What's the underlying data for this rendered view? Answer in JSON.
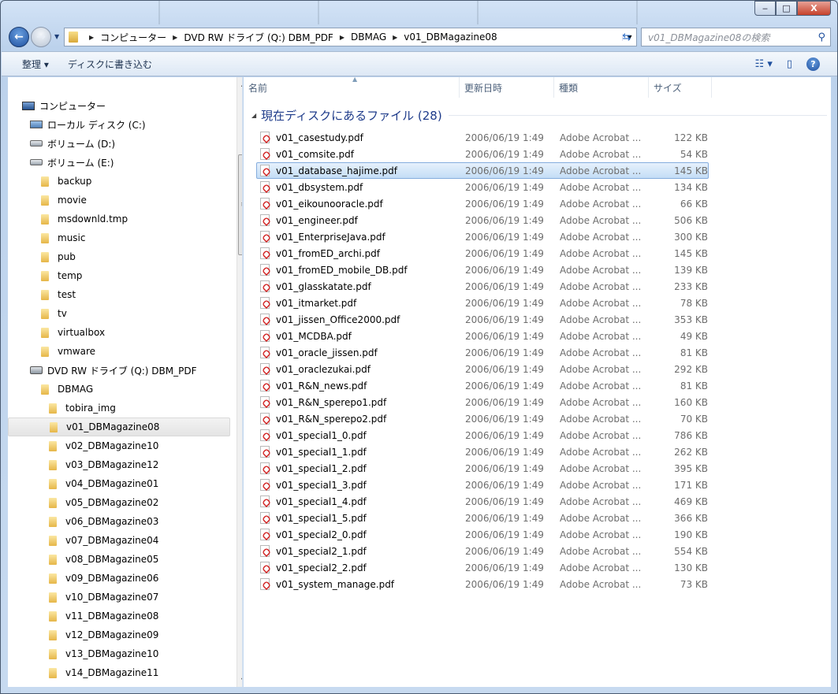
{
  "window": {
    "minimize": "‒",
    "maximize": "□",
    "close": "X"
  },
  "address": {
    "crumbs": [
      "コンピューター",
      "DVD RW ドライブ (Q:) DBM_PDF",
      "DBMAG",
      "v01_DBMagazine08"
    ]
  },
  "search": {
    "placeholder": "v01_DBMagazine08の検索"
  },
  "toolbar": {
    "organize": "整理 ▾",
    "burn": "ディスクに書き込む"
  },
  "columns": {
    "name": "名前",
    "date": "更新日時",
    "type": "種類",
    "size": "サイズ"
  },
  "group": {
    "label": "現在ディスクにあるファイル (28)"
  },
  "tree": [
    {
      "label": "コンピューター",
      "icon": "pc",
      "indent": 0
    },
    {
      "label": "ローカル ディスク (C:)",
      "icon": "sys",
      "indent": 1
    },
    {
      "label": "ボリューム (D:)",
      "icon": "drive",
      "indent": 1
    },
    {
      "label": "ボリューム (E:)",
      "icon": "drive",
      "indent": 1
    },
    {
      "label": "backup",
      "icon": "folder",
      "indent": 2
    },
    {
      "label": "movie",
      "icon": "folder",
      "indent": 2
    },
    {
      "label": "msdownld.tmp",
      "icon": "folder",
      "indent": 2
    },
    {
      "label": "music",
      "icon": "folder",
      "indent": 2
    },
    {
      "label": "pub",
      "icon": "folder",
      "indent": 2
    },
    {
      "label": "temp",
      "icon": "folder",
      "indent": 2
    },
    {
      "label": "test",
      "icon": "folder",
      "indent": 2
    },
    {
      "label": "tv",
      "icon": "folder",
      "indent": 2
    },
    {
      "label": "virtualbox",
      "icon": "folder",
      "indent": 2
    },
    {
      "label": "vmware",
      "icon": "folder",
      "indent": 2
    },
    {
      "label": "DVD RW ドライブ (Q:) DBM_PDF",
      "icon": "dvd",
      "indent": 1
    },
    {
      "label": "DBMAG",
      "icon": "folder",
      "indent": 2
    },
    {
      "label": "tobira_img",
      "icon": "folder",
      "indent": 3
    },
    {
      "label": "v01_DBMagazine08",
      "icon": "folder",
      "indent": 3,
      "selected": true
    },
    {
      "label": "v02_DBMagazine10",
      "icon": "folder",
      "indent": 3
    },
    {
      "label": "v03_DBMagazine12",
      "icon": "folder",
      "indent": 3
    },
    {
      "label": "v04_DBMagazine01",
      "icon": "folder",
      "indent": 3
    },
    {
      "label": "v05_DBMagazine02",
      "icon": "folder",
      "indent": 3
    },
    {
      "label": "v06_DBMagazine03",
      "icon": "folder",
      "indent": 3
    },
    {
      "label": "v07_DBMagazine04",
      "icon": "folder",
      "indent": 3
    },
    {
      "label": "v08_DBMagazine05",
      "icon": "folder",
      "indent": 3
    },
    {
      "label": "v09_DBMagazine06",
      "icon": "folder",
      "indent": 3
    },
    {
      "label": "v10_DBMagazine07",
      "icon": "folder",
      "indent": 3
    },
    {
      "label": "v11_DBMagazine08",
      "icon": "folder",
      "indent": 3
    },
    {
      "label": "v12_DBMagazine09",
      "icon": "folder",
      "indent": 3
    },
    {
      "label": "v13_DBMagazine10",
      "icon": "folder",
      "indent": 3
    },
    {
      "label": "v14_DBMagazine11",
      "icon": "folder",
      "indent": 3
    }
  ],
  "files": [
    {
      "name": "v01_casestudy.pdf",
      "date": "2006/06/19 1:49",
      "type": "Adobe Acrobat ...",
      "size": "122 KB"
    },
    {
      "name": "v01_comsite.pdf",
      "date": "2006/06/19 1:49",
      "type": "Adobe Acrobat ...",
      "size": "54 KB"
    },
    {
      "name": "v01_database_hajime.pdf",
      "date": "2006/06/19 1:49",
      "type": "Adobe Acrobat ...",
      "size": "145 KB",
      "selected": true
    },
    {
      "name": "v01_dbsystem.pdf",
      "date": "2006/06/19 1:49",
      "type": "Adobe Acrobat ...",
      "size": "134 KB"
    },
    {
      "name": "v01_eikounooracle.pdf",
      "date": "2006/06/19 1:49",
      "type": "Adobe Acrobat ...",
      "size": "66 KB"
    },
    {
      "name": "v01_engineer.pdf",
      "date": "2006/06/19 1:49",
      "type": "Adobe Acrobat ...",
      "size": "506 KB"
    },
    {
      "name": "v01_EnterpriseJava.pdf",
      "date": "2006/06/19 1:49",
      "type": "Adobe Acrobat ...",
      "size": "300 KB"
    },
    {
      "name": "v01_fromED_archi.pdf",
      "date": "2006/06/19 1:49",
      "type": "Adobe Acrobat ...",
      "size": "145 KB"
    },
    {
      "name": "v01_fromED_mobile_DB.pdf",
      "date": "2006/06/19 1:49",
      "type": "Adobe Acrobat ...",
      "size": "139 KB"
    },
    {
      "name": "v01_glasskatate.pdf",
      "date": "2006/06/19 1:49",
      "type": "Adobe Acrobat ...",
      "size": "233 KB"
    },
    {
      "name": "v01_itmarket.pdf",
      "date": "2006/06/19 1:49",
      "type": "Adobe Acrobat ...",
      "size": "78 KB"
    },
    {
      "name": "v01_jissen_Office2000.pdf",
      "date": "2006/06/19 1:49",
      "type": "Adobe Acrobat ...",
      "size": "353 KB"
    },
    {
      "name": "v01_MCDBA.pdf",
      "date": "2006/06/19 1:49",
      "type": "Adobe Acrobat ...",
      "size": "49 KB"
    },
    {
      "name": "v01_oracle_jissen.pdf",
      "date": "2006/06/19 1:49",
      "type": "Adobe Acrobat ...",
      "size": "81 KB"
    },
    {
      "name": "v01_oraclezukai.pdf",
      "date": "2006/06/19 1:49",
      "type": "Adobe Acrobat ...",
      "size": "292 KB"
    },
    {
      "name": "v01_R&N_news.pdf",
      "date": "2006/06/19 1:49",
      "type": "Adobe Acrobat ...",
      "size": "81 KB"
    },
    {
      "name": "v01_R&N_sperepo1.pdf",
      "date": "2006/06/19 1:49",
      "type": "Adobe Acrobat ...",
      "size": "160 KB"
    },
    {
      "name": "v01_R&N_sperepo2.pdf",
      "date": "2006/06/19 1:49",
      "type": "Adobe Acrobat ...",
      "size": "70 KB"
    },
    {
      "name": "v01_special1_0.pdf",
      "date": "2006/06/19 1:49",
      "type": "Adobe Acrobat ...",
      "size": "786 KB"
    },
    {
      "name": "v01_special1_1.pdf",
      "date": "2006/06/19 1:49",
      "type": "Adobe Acrobat ...",
      "size": "262 KB"
    },
    {
      "name": "v01_special1_2.pdf",
      "date": "2006/06/19 1:49",
      "type": "Adobe Acrobat ...",
      "size": "395 KB"
    },
    {
      "name": "v01_special1_3.pdf",
      "date": "2006/06/19 1:49",
      "type": "Adobe Acrobat ...",
      "size": "171 KB"
    },
    {
      "name": "v01_special1_4.pdf",
      "date": "2006/06/19 1:49",
      "type": "Adobe Acrobat ...",
      "size": "469 KB"
    },
    {
      "name": "v01_special1_5.pdf",
      "date": "2006/06/19 1:49",
      "type": "Adobe Acrobat ...",
      "size": "366 KB"
    },
    {
      "name": "v01_special2_0.pdf",
      "date": "2006/06/19 1:49",
      "type": "Adobe Acrobat ...",
      "size": "190 KB"
    },
    {
      "name": "v01_special2_1.pdf",
      "date": "2006/06/19 1:49",
      "type": "Adobe Acrobat ...",
      "size": "554 KB"
    },
    {
      "name": "v01_special2_2.pdf",
      "date": "2006/06/19 1:49",
      "type": "Adobe Acrobat ...",
      "size": "130 KB"
    },
    {
      "name": "v01_system_manage.pdf",
      "date": "2006/06/19 1:49",
      "type": "Adobe Acrobat ...",
      "size": "73 KB"
    }
  ]
}
